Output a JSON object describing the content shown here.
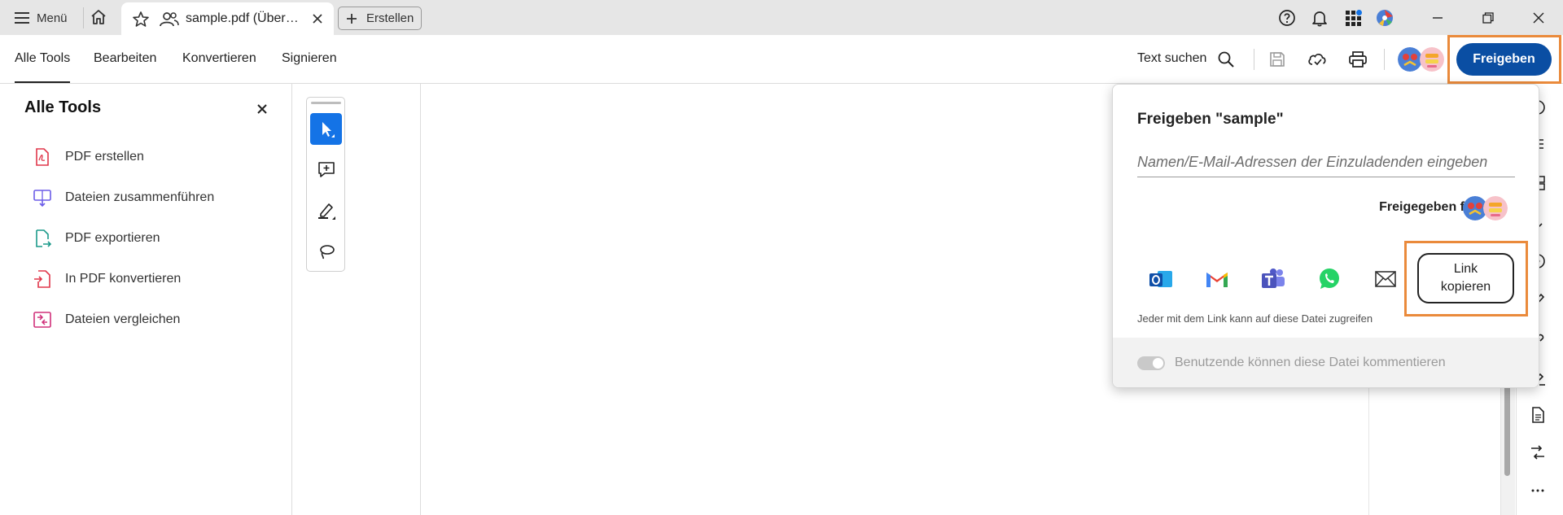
{
  "titlebar": {
    "menu_label": "Menü",
    "tab_title": "sample.pdf (Über…",
    "new_button_label": "Erstellen"
  },
  "toolbar": {
    "tabs": [
      "Alle Tools",
      "Bearbeiten",
      "Konvertieren",
      "Signieren"
    ],
    "search_label": "Text suchen",
    "share_label": "Freigeben"
  },
  "left_panel": {
    "title": "Alle Tools",
    "items": [
      {
        "label": "PDF erstellen",
        "icon": "pdf-create-icon",
        "color": "#e0364a"
      },
      {
        "label": "Dateien zusammenführen",
        "icon": "merge-files-icon",
        "color": "#6b5ce7"
      },
      {
        "label": "PDF exportieren",
        "icon": "export-pdf-icon",
        "color": "#1c9a8a"
      },
      {
        "label": "In PDF konvertieren",
        "icon": "convert-to-pdf-icon",
        "color": "#e0364a"
      },
      {
        "label": "Dateien vergleichen",
        "icon": "compare-files-icon",
        "color": "#d0307a"
      }
    ]
  },
  "share_popover": {
    "title": "Freigeben \"sample\"",
    "recipient_placeholder": "Namen/E-Mail-Adressen der Einzuladenden eingeben",
    "shared_with_label": "Freigegeben für",
    "apps": [
      "outlook-icon",
      "gmail-icon",
      "teams-icon",
      "whatsapp-icon",
      "mail-icon"
    ],
    "copy_link_line1": "Link",
    "copy_link_line2": "kopieren",
    "link_note": "Jeder mit dem Link kann auf diese Datei zugreifen",
    "comment_toggle_label": "Benutzende können diese Datei kommentieren",
    "comment_toggle_on": false
  },
  "colors": {
    "accent_blue": "#0a4ea3",
    "tool_active": "#1473e6",
    "highlight_orange": "#ea8a3b"
  }
}
